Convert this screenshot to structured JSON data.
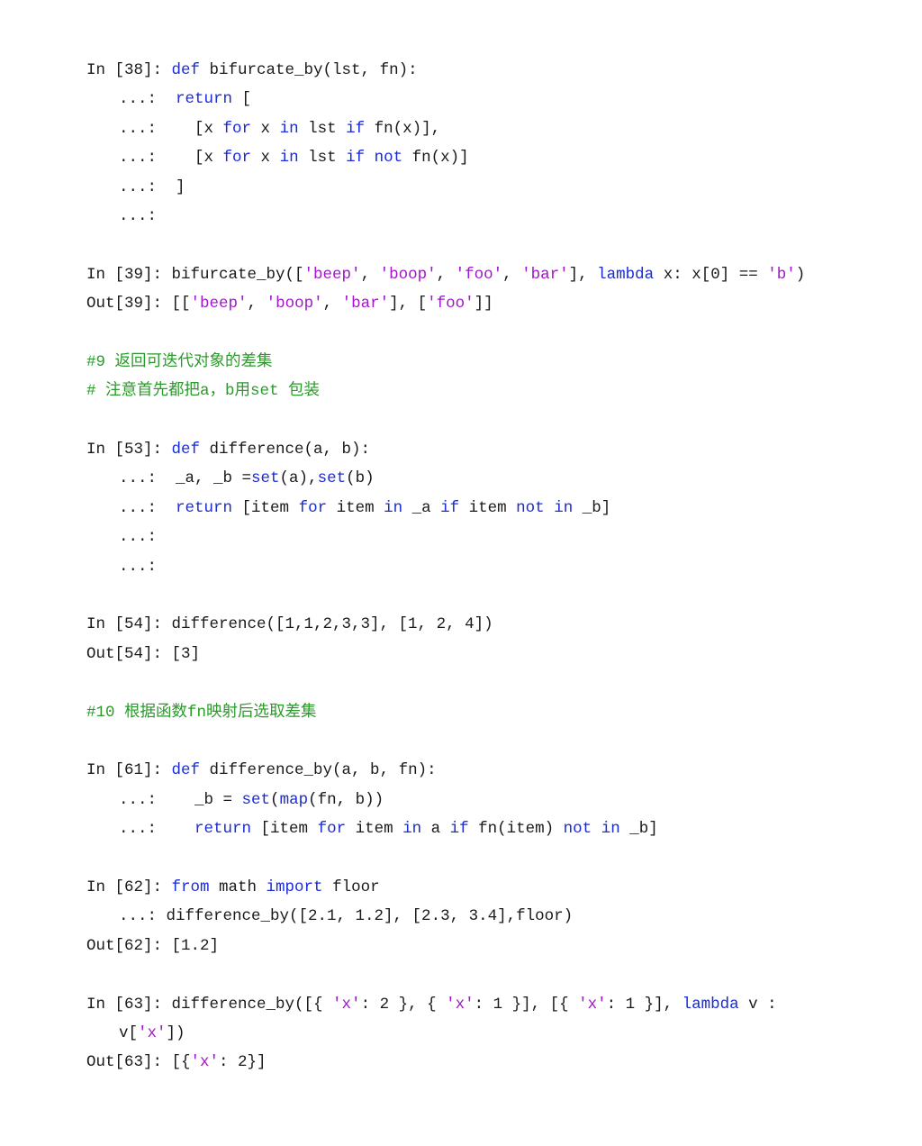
{
  "cells": [
    {
      "id": "in38",
      "lines": [
        [
          {
            "t": "p",
            "v": "In [38]: "
          },
          {
            "t": "k",
            "v": "def"
          },
          {
            "t": "n",
            "v": " bifurcate_by(lst, fn):"
          }
        ],
        [
          {
            "t": "d",
            "v": "...: "
          },
          {
            "t": "n",
            "v": " "
          },
          {
            "t": "k",
            "v": "return"
          },
          {
            "t": "n",
            "v": " ["
          }
        ],
        [
          {
            "t": "d",
            "v": "...: "
          },
          {
            "t": "n",
            "v": "   [x "
          },
          {
            "t": "k",
            "v": "for"
          },
          {
            "t": "n",
            "v": " x "
          },
          {
            "t": "k",
            "v": "in"
          },
          {
            "t": "n",
            "v": " lst "
          },
          {
            "t": "k",
            "v": "if"
          },
          {
            "t": "n",
            "v": " fn(x)],"
          }
        ],
        [
          {
            "t": "d",
            "v": "...: "
          },
          {
            "t": "n",
            "v": "   [x "
          },
          {
            "t": "k",
            "v": "for"
          },
          {
            "t": "n",
            "v": " x "
          },
          {
            "t": "k",
            "v": "in"
          },
          {
            "t": "n",
            "v": " lst "
          },
          {
            "t": "k",
            "v": "if"
          },
          {
            "t": "n",
            "v": " "
          },
          {
            "t": "k",
            "v": "not"
          },
          {
            "t": "n",
            "v": " fn(x)]"
          }
        ],
        [
          {
            "t": "d",
            "v": "...: "
          },
          {
            "t": "n",
            "v": " ]"
          }
        ],
        [
          {
            "t": "d",
            "v": "...: "
          }
        ]
      ]
    },
    {
      "id": "in39",
      "lines": [
        [
          {
            "t": "p",
            "v": "In [39]: "
          },
          {
            "t": "n",
            "v": "bifurcate_by(["
          },
          {
            "t": "s",
            "v": "'beep'"
          },
          {
            "t": "n",
            "v": ", "
          },
          {
            "t": "s",
            "v": "'boop'"
          },
          {
            "t": "n",
            "v": ", "
          },
          {
            "t": "s",
            "v": "'foo'"
          },
          {
            "t": "n",
            "v": ", "
          },
          {
            "t": "s",
            "v": "'bar'"
          },
          {
            "t": "n",
            "v": "], "
          },
          {
            "t": "k",
            "v": "lambda"
          },
          {
            "t": "n",
            "v": " x: x[0] == "
          },
          {
            "t": "s",
            "v": "'b'"
          },
          {
            "t": "n",
            "v": ")"
          }
        ],
        [
          {
            "t": "p",
            "v": "Out[39]: "
          },
          {
            "t": "n",
            "v": "[["
          },
          {
            "t": "s",
            "v": "'beep'"
          },
          {
            "t": "n",
            "v": ", "
          },
          {
            "t": "s",
            "v": "'boop'"
          },
          {
            "t": "n",
            "v": ", "
          },
          {
            "t": "s",
            "v": "'bar'"
          },
          {
            "t": "n",
            "v": "], ["
          },
          {
            "t": "s",
            "v": "'foo'"
          },
          {
            "t": "n",
            "v": "]]"
          }
        ]
      ]
    },
    {
      "id": "comment9",
      "lines": [
        [
          {
            "t": "c",
            "v": "#9 返回可迭代对象的差集"
          }
        ],
        [
          {
            "t": "c",
            "v": "# 注意首先都把a，b用set 包装"
          }
        ]
      ]
    },
    {
      "id": "in53",
      "lines": [
        [
          {
            "t": "p",
            "v": "In [53]: "
          },
          {
            "t": "k",
            "v": "def"
          },
          {
            "t": "n",
            "v": " difference(a, b):"
          }
        ],
        [
          {
            "t": "d",
            "v": "...: "
          },
          {
            "t": "n",
            "v": " _a, _b ="
          },
          {
            "t": "k",
            "v": "set"
          },
          {
            "t": "n",
            "v": "(a),"
          },
          {
            "t": "k",
            "v": "set"
          },
          {
            "t": "n",
            "v": "(b)"
          }
        ],
        [
          {
            "t": "d",
            "v": "...: "
          },
          {
            "t": "n",
            "v": " "
          },
          {
            "t": "k",
            "v": "return"
          },
          {
            "t": "n",
            "v": " [item "
          },
          {
            "t": "k",
            "v": "for"
          },
          {
            "t": "n",
            "v": " item "
          },
          {
            "t": "k",
            "v": "in"
          },
          {
            "t": "n",
            "v": " _a "
          },
          {
            "t": "k",
            "v": "if"
          },
          {
            "t": "n",
            "v": " item "
          },
          {
            "t": "k",
            "v": "not"
          },
          {
            "t": "n",
            "v": " "
          },
          {
            "t": "k",
            "v": "in"
          },
          {
            "t": "n",
            "v": " _b]"
          }
        ],
        [
          {
            "t": "d",
            "v": "...: "
          }
        ],
        [
          {
            "t": "d",
            "v": "...: "
          }
        ]
      ]
    },
    {
      "id": "in54",
      "lines": [
        [
          {
            "t": "p",
            "v": "In [54]: "
          },
          {
            "t": "n",
            "v": "difference([1,1,2,3,3], [1, 2, 4])"
          }
        ],
        [
          {
            "t": "p",
            "v": "Out[54]: "
          },
          {
            "t": "n",
            "v": "[3]"
          }
        ]
      ]
    },
    {
      "id": "comment10",
      "lines": [
        [
          {
            "t": "c",
            "v": "#10 根据函数fn映射后选取差集"
          }
        ]
      ]
    },
    {
      "id": "in61",
      "lines": [
        [
          {
            "t": "p",
            "v": "In [61]: "
          },
          {
            "t": "k",
            "v": "def"
          },
          {
            "t": "n",
            "v": " difference_by(a, b, fn):"
          }
        ],
        [
          {
            "t": "d",
            "v": "...: "
          },
          {
            "t": "n",
            "v": "   _b = "
          },
          {
            "t": "k",
            "v": "set"
          },
          {
            "t": "n",
            "v": "("
          },
          {
            "t": "k",
            "v": "map"
          },
          {
            "t": "n",
            "v": "(fn, b))"
          }
        ],
        [
          {
            "t": "d",
            "v": "...: "
          },
          {
            "t": "n",
            "v": "   "
          },
          {
            "t": "k",
            "v": "return"
          },
          {
            "t": "n",
            "v": " [item "
          },
          {
            "t": "k",
            "v": "for"
          },
          {
            "t": "n",
            "v": " item "
          },
          {
            "t": "k",
            "v": "in"
          },
          {
            "t": "n",
            "v": " a "
          },
          {
            "t": "k",
            "v": "if"
          },
          {
            "t": "n",
            "v": " fn(item) "
          },
          {
            "t": "k",
            "v": "not"
          },
          {
            "t": "n",
            "v": " "
          },
          {
            "t": "k",
            "v": "in"
          },
          {
            "t": "n",
            "v": " _b]"
          }
        ]
      ]
    },
    {
      "id": "in62",
      "lines": [
        [
          {
            "t": "p",
            "v": "In [62]: "
          },
          {
            "t": "k",
            "v": "from"
          },
          {
            "t": "n",
            "v": " math "
          },
          {
            "t": "k",
            "v": "import"
          },
          {
            "t": "n",
            "v": " floor"
          }
        ],
        [
          {
            "t": "d",
            "v": "...: "
          },
          {
            "t": "n",
            "v": "difference_by([2.1, 1.2], [2.3, 3.4],floor)"
          }
        ],
        [
          {
            "t": "p",
            "v": "Out[62]: "
          },
          {
            "t": "n",
            "v": "[1.2]"
          }
        ]
      ]
    },
    {
      "id": "in63",
      "lines": [
        [
          {
            "t": "p",
            "v": "In [63]: "
          },
          {
            "t": "n",
            "v": "difference_by([{ "
          },
          {
            "t": "s",
            "v": "'x'"
          },
          {
            "t": "n",
            "v": ": 2 }, { "
          },
          {
            "t": "s",
            "v": "'x'"
          },
          {
            "t": "n",
            "v": ": 1 }], [{ "
          },
          {
            "t": "s",
            "v": "'x'"
          },
          {
            "t": "n",
            "v": ": 1 }], "
          },
          {
            "t": "k",
            "v": "lambda"
          },
          {
            "t": "n",
            "v": " v :"
          }
        ],
        [
          {
            "t": "w",
            "v": ""
          },
          {
            "t": "n",
            "v": "v["
          },
          {
            "t": "s",
            "v": "'x'"
          },
          {
            "t": "n",
            "v": "])"
          }
        ],
        [
          {
            "t": "p",
            "v": "Out[63]: "
          },
          {
            "t": "n",
            "v": "[{"
          },
          {
            "t": "s",
            "v": "'x'"
          },
          {
            "t": "n",
            "v": ": 2}]"
          }
        ]
      ]
    }
  ],
  "colors": {
    "keyword": "#1a2bd8",
    "string": "#a018c8",
    "comment": "#2a9a2a",
    "text": "#1a1a1a"
  }
}
